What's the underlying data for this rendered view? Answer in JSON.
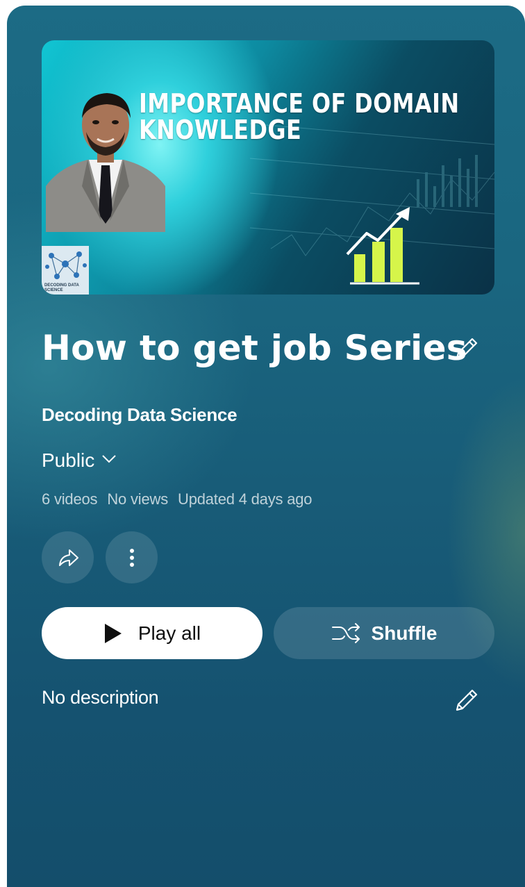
{
  "playlist": {
    "thumbnail": {
      "headline": "IMPORTANCE OF DOMAIN KNOWLEDGE",
      "logo_text": "DECODING DATA SCIENCE",
      "icons": [
        "presenter-photo",
        "channel-logo",
        "growth-chart-icon"
      ]
    },
    "title": "How to get job Series",
    "channel_name": "Decoding Data Science",
    "privacy": "Public",
    "stats": {
      "video_count": "6 videos",
      "views": "No views",
      "updated": "Updated 4 days ago"
    },
    "actions": {
      "share_icon": "share-icon",
      "more_icon": "more-vertical-icon",
      "play_all_label": "Play all",
      "shuffle_label": "Shuffle"
    },
    "description": "No description"
  },
  "colors": {
    "card_background": "#185c78",
    "play_button_bg": "#ffffff",
    "thumbnail_chart": "#d6f54a"
  }
}
